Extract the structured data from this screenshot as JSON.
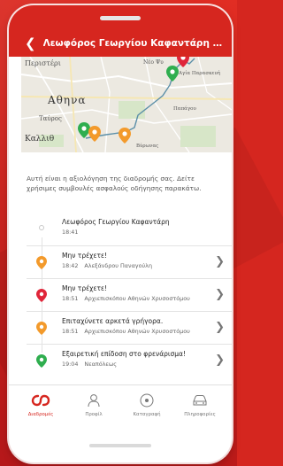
{
  "header": {
    "back_icon": "chevron-left-icon",
    "title": "Λεωφόρος Γεωργίου Καφαντάρη - Ασπ..."
  },
  "map": {
    "labels": {
      "peristeri": "Περιστέρι",
      "athina": "Αθηνα",
      "tavros": "Ταύρος",
      "kallithea": "Καλλιθ",
      "neo_psychiko": "Νέο Ψυ",
      "agia_paraskevi": "Αγία Παρασκευή",
      "papagou": "Παπάγου",
      "vyronas": "Βύρωνας"
    }
  },
  "intro": "Αυτή είναι η αξιολόγηση της διαδρομής σας. Δείτε χρήσιμες συμβουλές ασφαλούς οδήγησης παρακάτω.",
  "events": [
    {
      "title": "Λεωφόρος Γεωργίου Καφαντάρη",
      "time": "18:41",
      "street": "",
      "marker": "start",
      "color": "#c8c8c8"
    },
    {
      "title": "Μην τρέχετε!",
      "time": "18:42",
      "street": "Αλεξάνδρου Παναγούλη",
      "marker": "pin",
      "color": "#f39a2b"
    },
    {
      "title": "Μην τρέχετε!",
      "time": "18:51",
      "street": "Αρχιεπισκόπου Αθηνών Χρυσοστόμου",
      "marker": "pin",
      "color": "#e0263a"
    },
    {
      "title": "Επιταχύνετε αρκετά γρήγορα.",
      "time": "18:51",
      "street": "Αρχιεπισκόπου Αθηνών Χρυσοστόμου",
      "marker": "pin",
      "color": "#f39a2b"
    },
    {
      "title": "Εξαιρετική επίδοση στο φρενάρισμα!",
      "time": "19:04",
      "street": "Νεαπόλεως",
      "marker": "pin",
      "color": "#2fae4f"
    }
  ],
  "tabs": [
    {
      "label": "Διαδρομές",
      "icon": "routes-icon",
      "active": true
    },
    {
      "label": "Προφίλ",
      "icon": "profile-icon",
      "active": false
    },
    {
      "label": "Καταγραφή",
      "icon": "record-icon",
      "active": false
    },
    {
      "label": "Πληροφορίες",
      "icon": "car-info-icon",
      "active": false
    }
  ],
  "colors": {
    "brand": "#d6261f",
    "orange": "#f39a2b",
    "red": "#e0263a",
    "green": "#2fae4f",
    "route": "#5b8fa8"
  }
}
